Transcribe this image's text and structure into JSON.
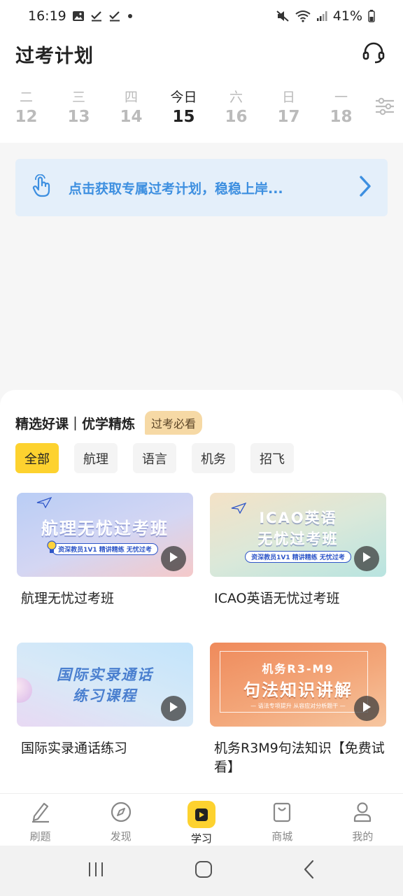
{
  "status_bar": {
    "time": "16:19",
    "battery": "41%"
  },
  "header": {
    "title": "过考计划"
  },
  "week": [
    {
      "name": "二",
      "num": "12",
      "active": false
    },
    {
      "name": "三",
      "num": "13",
      "active": false
    },
    {
      "name": "四",
      "num": "14",
      "active": false
    },
    {
      "name": "今日",
      "num": "15",
      "active": true
    },
    {
      "name": "六",
      "num": "16",
      "active": false
    },
    {
      "name": "日",
      "num": "17",
      "active": false
    },
    {
      "name": "一",
      "num": "18",
      "active": false
    }
  ],
  "banner": {
    "text": "点击获取专属过考计划，稳稳上岸..."
  },
  "courses_section": {
    "title": "精选好课｜优学精炼",
    "tag": "过考必看",
    "categories": [
      "全部",
      "航理",
      "语言",
      "机务",
      "招飞"
    ],
    "selected_category": "全部",
    "cards": [
      {
        "thumb_title": "航理无忧过考班",
        "thumb_sub": "资深教员1V1 精讲精练 无忧过考",
        "title": "航理无忧过考班"
      },
      {
        "thumb_title": "ICAO英语",
        "thumb_title2": "无忧过考班",
        "thumb_sub": "资深教员1V1 精讲精练 无忧过考",
        "title": "ICAO英语无忧过考班"
      },
      {
        "thumb_title": "国际实录通话",
        "thumb_title2": "练习课程",
        "title": "国际实录通话练习"
      },
      {
        "thumb_title": "机务R3-M9",
        "thumb_title2": "句法知识讲解",
        "thumb_sub": "— 语法专项提升 从容应对分析题干 —",
        "title": "机务R3M9句法知识【免费试看】"
      }
    ]
  },
  "tab_bar": {
    "items": [
      {
        "label": "刷题",
        "icon": "pencil-icon"
      },
      {
        "label": "发现",
        "icon": "compass-icon"
      },
      {
        "label": "学习",
        "icon": "play-icon",
        "active": true
      },
      {
        "label": "商城",
        "icon": "shopping-bag-icon"
      },
      {
        "label": "我的",
        "icon": "user-icon"
      }
    ]
  },
  "colors": {
    "accent": "#fdd22f",
    "banner_text": "#3d8fe0",
    "banner_bg": "#e4effa"
  }
}
